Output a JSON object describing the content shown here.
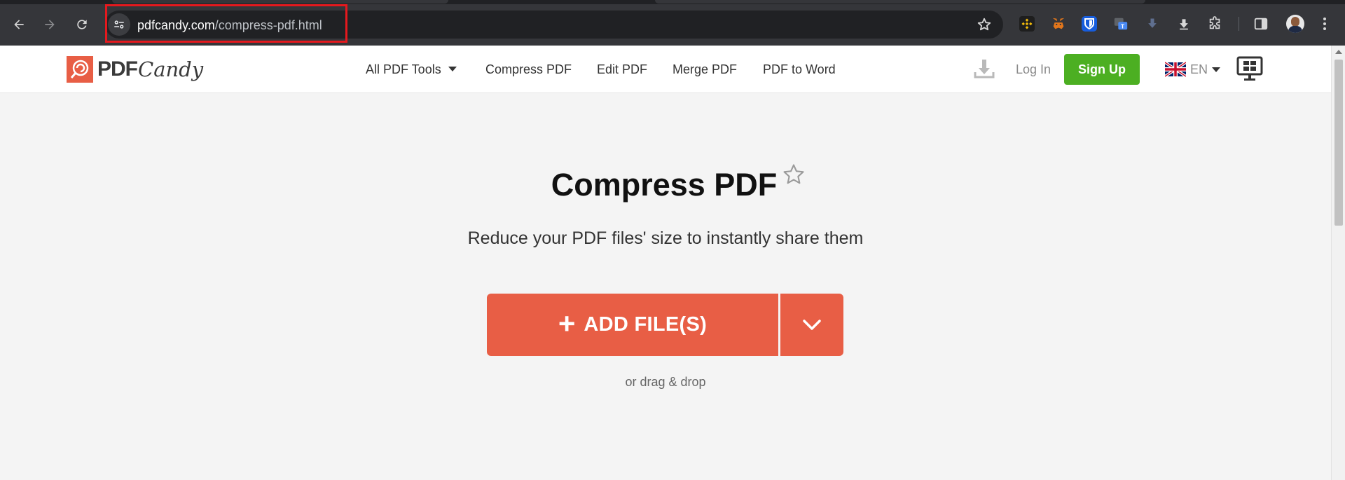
{
  "browser": {
    "url_domain": "pdfcandy.com",
    "url_path": "/compress-pdf.html",
    "extensions": [
      {
        "name": "binance-extension-icon",
        "color": "#f0b90b"
      },
      {
        "name": "metamask-extension-icon",
        "color": "#e2761b"
      },
      {
        "name": "bitwarden-extension-icon",
        "color": "#175ddc"
      },
      {
        "name": "translate-extension-icon",
        "color": "#4a8af4"
      },
      {
        "name": "downloader-extension-icon",
        "color": "#5f6f8f"
      },
      {
        "name": "download-extension-icon",
        "color": "#d7d7d7"
      },
      {
        "name": "extensions-puzzle-icon",
        "color": "#d7d7d7"
      }
    ]
  },
  "header": {
    "logo_pdf": "PDF",
    "logo_candy": "Candy",
    "nav": {
      "all_tools": "All PDF Tools",
      "compress": "Compress PDF",
      "edit": "Edit PDF",
      "merge": "Merge PDF",
      "to_word": "PDF to Word"
    },
    "login": "Log In",
    "signup": "Sign Up",
    "lang": "EN"
  },
  "main": {
    "title": "Compress PDF",
    "subtitle": "Reduce your PDF files' size to instantly share them",
    "add_files": "ADD FILE(S)",
    "plus": "+",
    "drag_drop": "or drag & drop"
  },
  "colors": {
    "accent": "#e85e45",
    "signup": "#4caf22",
    "highlight": "#e5191e"
  }
}
